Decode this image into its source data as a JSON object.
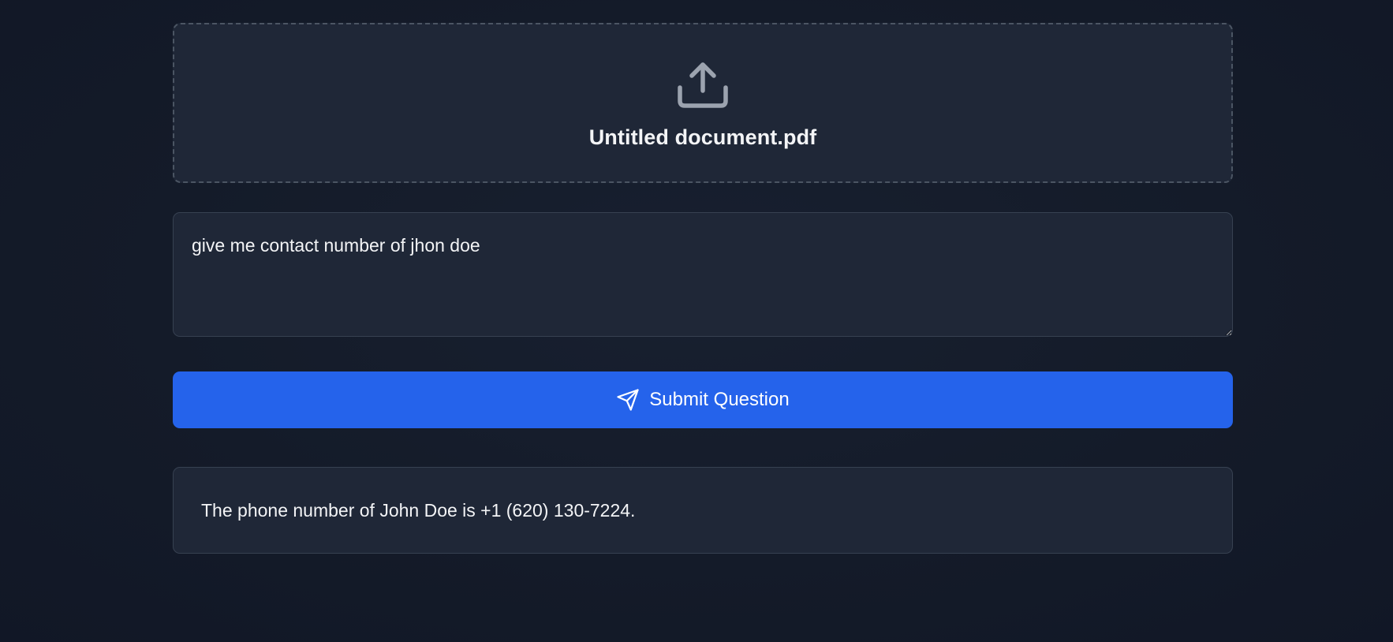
{
  "upload": {
    "icon": "upload-icon",
    "file_name": "Untitled document.pdf"
  },
  "question": {
    "value": "give me contact number of jhon doe"
  },
  "submit": {
    "icon": "send-icon",
    "label": "Submit Question"
  },
  "answer": {
    "text": "The phone number of John Doe is +1 (620) 130-7224."
  },
  "colors": {
    "background": "#151c2b",
    "card": "#1f2737",
    "accent": "#2563eb",
    "icon": "#9ca3af",
    "text": "#f3f4f6"
  }
}
